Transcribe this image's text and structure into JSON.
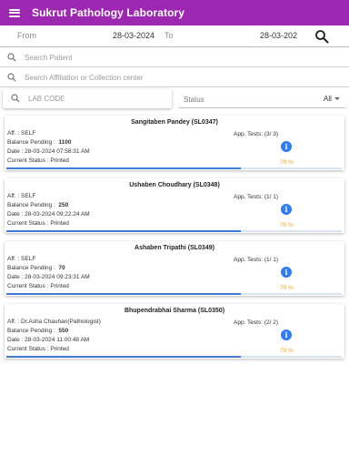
{
  "app_bar": {
    "title": "Sukrut Pathology Laboratory"
  },
  "date_filter": {
    "from_label": "From",
    "from_value": "28-03-2024",
    "to_label": "To",
    "to_value": "28-03-202"
  },
  "search": {
    "patient_placeholder": "Search Patient",
    "affiliation_placeholder": "Search Affiliation or Collection center",
    "labcode_placeholder": "LAB CODE"
  },
  "status_filter": {
    "label": "Status",
    "value": "All"
  },
  "colors": {
    "app_bar": "#9c27b0",
    "info_icon": "#2e7cf6",
    "percent_text": "#f0a030",
    "progress_fill": "#3d7ad6"
  },
  "icons": {
    "menu": "hamburger-menu-icon",
    "search": "magnifier-search-icon",
    "info": "info-icon"
  },
  "patients": [
    {
      "name": "Sangitaben Pandey  (SL0347)",
      "aff": "Aff. : SELF",
      "balance_label": "Balance Pending :",
      "balance": "1100",
      "date": "Date : 28-03-2024 07:58:31 AM",
      "status": "Current Status : Printed",
      "tests": "App. Tests: (3/ 3)",
      "percent_label": "70 %",
      "progress": 0.7
    },
    {
      "name": "Ushaben Choudhary  (SL0348)",
      "aff": "Aff. : SELF",
      "balance_label": "Balance Pending :",
      "balance": "250",
      "date": "Date : 28-03-2024 09:22:24 AM",
      "status": "Current Status : Printed",
      "tests": "App. Tests: (1/ 1)",
      "percent_label": "70 %",
      "progress": 0.7
    },
    {
      "name": "Ashaben Tripathi  (SL0349)",
      "aff": "Aff. : SELF",
      "balance_label": "Balance Pending :",
      "balance": "70",
      "date": "Date : 28-03-2024 09:23:31 AM",
      "status": "Current Status : Printed",
      "tests": "App. Tests: (1/ 1)",
      "percent_label": "70 %",
      "progress": 0.7
    },
    {
      "name": "Bhupendrabhai Sharma  (SL0350)",
      "aff": "Aff. : Dr.Asha Chauhan(Pathologist)",
      "balance_label": "Balance Pending :",
      "balance": "550",
      "date": "Date : 28-03-2024 11:00:48 AM",
      "status": "Current Status : Printed",
      "tests": "App. Tests: (2/ 2)",
      "percent_label": "70 %",
      "progress": 0.7
    }
  ]
}
